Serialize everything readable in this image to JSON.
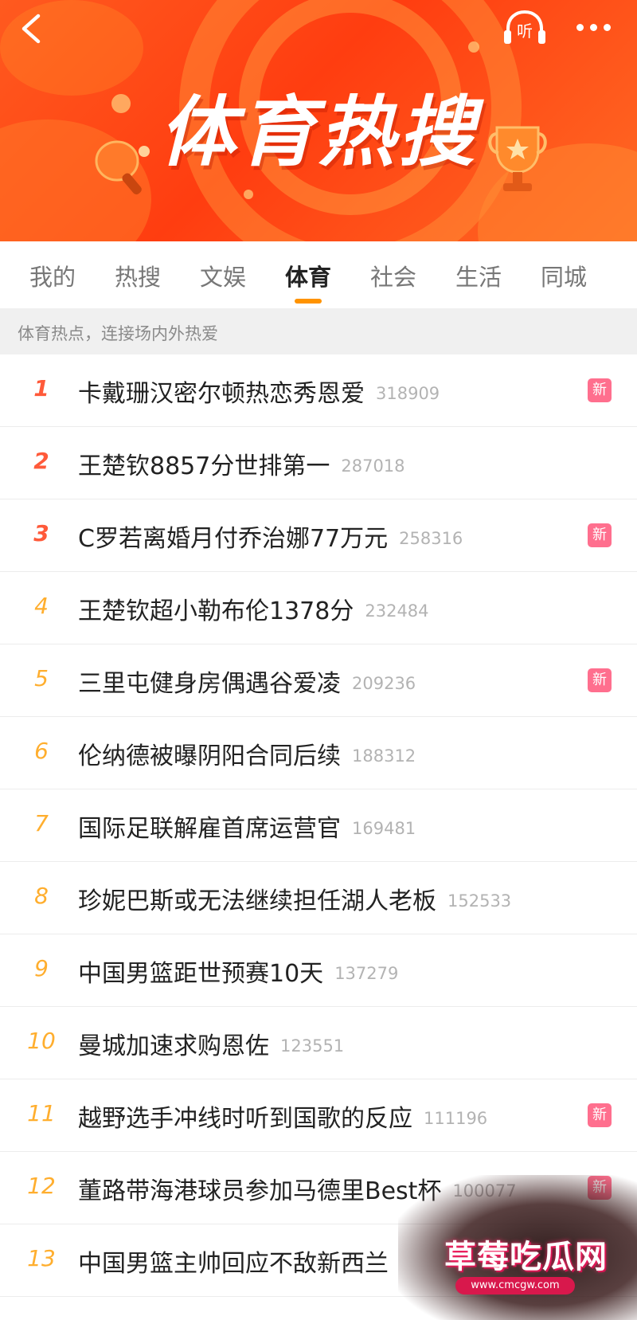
{
  "header": {
    "back_icon": "chevron-left-icon",
    "listen_label": "听",
    "listen_icon": "headphones-icon",
    "more_icon": "more-dots-icon",
    "banner_title": "体育热搜",
    "accent_color": "#ff4a16"
  },
  "tabs": [
    {
      "label": "我的",
      "active": false
    },
    {
      "label": "热搜",
      "active": false
    },
    {
      "label": "文娱",
      "active": false
    },
    {
      "label": "体育",
      "active": true
    },
    {
      "label": "社会",
      "active": false
    },
    {
      "label": "生活",
      "active": false
    },
    {
      "label": "同城",
      "active": false
    }
  ],
  "subtitle": "体育热点，连接场内外热爱",
  "badge_new": "新",
  "list": [
    {
      "rank": "1",
      "title": "卡戴珊汉密尔顿热恋秀恩爱",
      "count": "318909",
      "new": true
    },
    {
      "rank": "2",
      "title": "王楚钦8857分世排第一",
      "count": "287018",
      "new": false
    },
    {
      "rank": "3",
      "title": "C罗若离婚月付乔治娜77万元",
      "count": "258316",
      "new": true
    },
    {
      "rank": "4",
      "title": "王楚钦超小勒布伦1378分",
      "count": "232484",
      "new": false
    },
    {
      "rank": "5",
      "title": "三里屯健身房偶遇谷爱凌",
      "count": "209236",
      "new": true
    },
    {
      "rank": "6",
      "title": "伦纳德被曝阴阳合同后续",
      "count": "188312",
      "new": false
    },
    {
      "rank": "7",
      "title": "国际足联解雇首席运营官",
      "count": "169481",
      "new": false
    },
    {
      "rank": "8",
      "title": "珍妮巴斯或无法继续担任湖人老板",
      "count": "152533",
      "new": false
    },
    {
      "rank": "9",
      "title": "中国男篮距世预赛10天",
      "count": "137279",
      "new": false
    },
    {
      "rank": "10",
      "title": "曼城加速求购恩佐",
      "count": "123551",
      "new": false
    },
    {
      "rank": "11",
      "title": "越野选手冲线时听到国歌的反应",
      "count": "111196",
      "new": true
    },
    {
      "rank": "12",
      "title": "董路带海港球员参加马德里Best杯",
      "count": "100077",
      "new": true
    },
    {
      "rank": "13",
      "title": "中国男篮主帅回应不敌新西兰",
      "count": "",
      "new": false
    }
  ],
  "watermark": {
    "text": "草莓吃瓜网",
    "url": "www.cmcgw.com"
  }
}
